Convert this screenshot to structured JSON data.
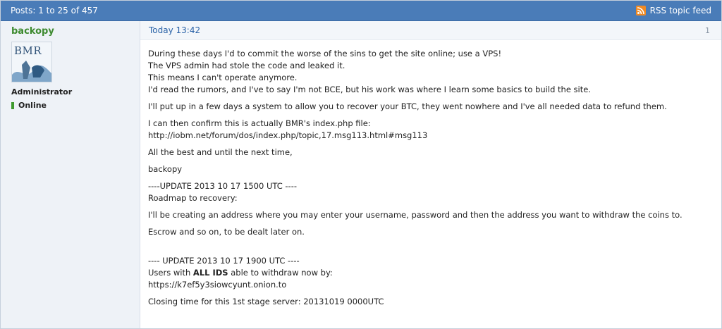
{
  "header": {
    "posts_text": "Posts: 1 to 25 of 457",
    "rss_label": "RSS topic feed"
  },
  "author": {
    "username": "backopy",
    "avatar_text": "BMR",
    "role": "Administrator",
    "status": "Online"
  },
  "post": {
    "date": "Today 13:42",
    "number": "1",
    "lines": {
      "l1": "During these days I'd to commit the worse of the sins to get the site online; use a VPS!",
      "l2": "The VPS admin had stole the code and leaked it.",
      "l3": "This means I can't operate anymore.",
      "l4": "I'd read the rumors, and I've to say I'm not BCE, but his work was where I learn some basics to build the site.",
      "l5": "I'll put up in a few days a system to allow you to recover your BTC, they went nowhere and I've all needed data to refund them.",
      "l6": "I can then confirm this is actually BMR's index.php file:",
      "l7": "http://iobm.net/forum/dos/index.php/topic,17.msg113.html#msg113",
      "l8": "All the best and until the next time,",
      "l9": "backopy",
      "l10": "----UPDATE 2013 10 17 1500 UTC ----",
      "l11": "Roadmap to recovery:",
      "l12": "I'll be creating an address where you may enter your username, password and then the address you want to withdraw the coins to.",
      "l13": "Escrow and so on, to be dealt later on.",
      "l14": "---- UPDATE 2013 10 17 1900 UTC ----",
      "l15a": "Users with ",
      "l15b": "ALL IDS",
      "l15c": " able to withdraw now by:",
      "l16": "https://k7ef5y3siowcyunt.onion.to",
      "l17": "Closing time for this 1st stage server: 20131019 0000UTC"
    }
  },
  "colors": {
    "header_bg": "#4a7cb8",
    "username": "#3d8a2f",
    "date_link": "#2a62a7",
    "online_dot": "#3f9a2f",
    "rss_orange": "#f08a24"
  }
}
